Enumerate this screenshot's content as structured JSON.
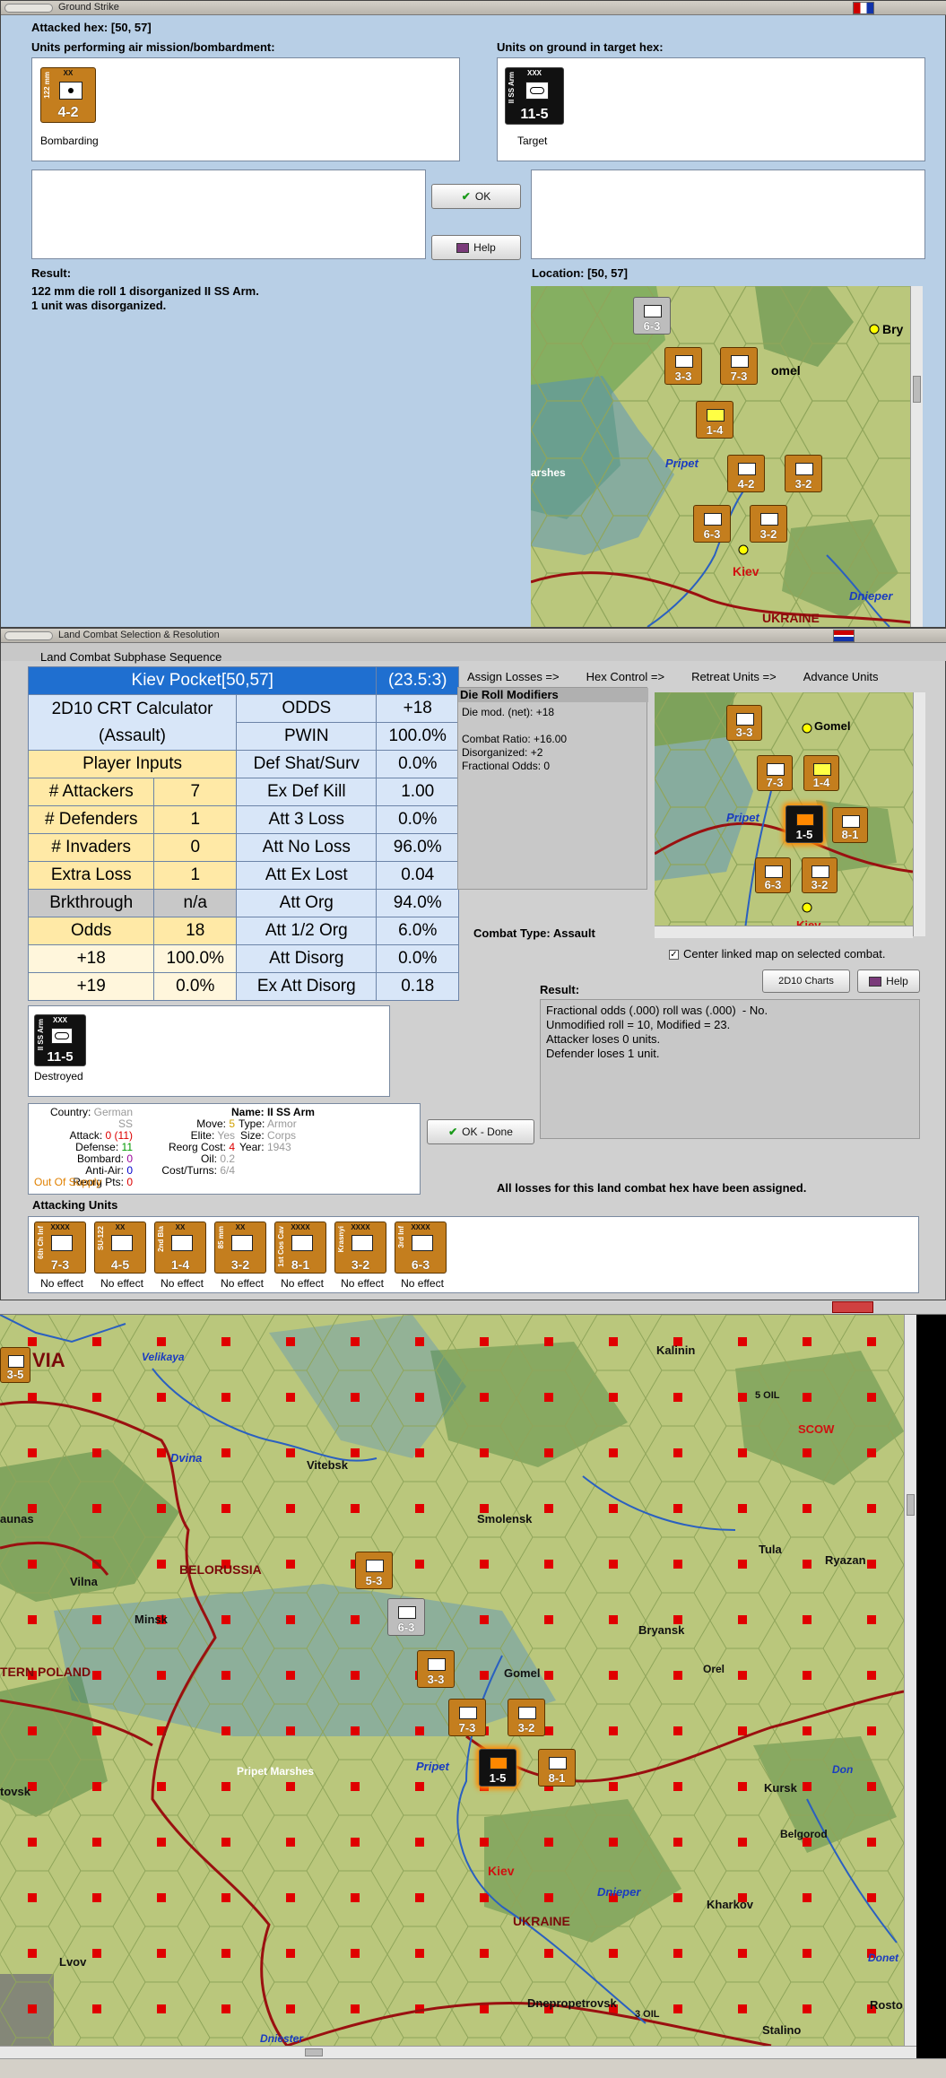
{
  "ground": {
    "title": "Ground Strike",
    "attacked_hex": "Attacked hex: [50, 57]",
    "units_air_label": "Units performing air mission/bombardment:",
    "units_ground_label": "Units on ground in target hex:",
    "air_unit": {
      "side": "122 mm",
      "size": "XX",
      "strength": "4-2",
      "caption": "Bombarding"
    },
    "ground_unit": {
      "side": "II SS Arm",
      "size": "XXX",
      "strength": "11-5",
      "caption": "Target"
    },
    "ok_label": "OK",
    "help_label": "Help",
    "result_label": "Result:",
    "result_lines": "122 mm die roll 1 disorganized II SS Arm.\n1 unit was disorganized.",
    "location_label": "Location:  [50, 57]",
    "map_labels": {
      "bryansk": "Bry",
      "gomel": "omel",
      "marshes": "arshes",
      "pripet": "Pripet",
      "kiev": "Kiev",
      "dnieper": "Dnieper",
      "ukraine": "UKRAINE"
    },
    "map_counters": [
      {
        "side": "XXXXX",
        "strength": "6-3",
        "grey": true
      },
      {
        "side": "XXXX",
        "strength": "3-3"
      },
      {
        "side": "XXXX",
        "strength": "7-3"
      },
      {
        "side": "XX",
        "strength": "1-4"
      },
      {
        "side": "XX",
        "strength": "4-2"
      },
      {
        "side": "XX",
        "strength": "3-2"
      },
      {
        "side": "XXXX",
        "strength": "6-3"
      },
      {
        "side": "XXXX",
        "strength": "3-2"
      }
    ]
  },
  "land": {
    "title": "Land Combat Selection & Resolution",
    "subphase_title": "Land Combat Subphase Sequence",
    "steps": [
      "Assign Losses =>",
      "Hex Control =>",
      "Retreat Units =>",
      "Advance Units"
    ],
    "crt": {
      "header_name": "Kiev Pocket[50,57]",
      "header_ratio": "(23.5:3)",
      "calc_title_1": "2D10 CRT Calculator",
      "calc_title_2": "(Assault)",
      "player_inputs": "Player Inputs",
      "rows_left": [
        {
          "label": "# Attackers",
          "value": "7"
        },
        {
          "label": "# Defenders",
          "value": "1"
        },
        {
          "label": "# Invaders",
          "value": "0"
        },
        {
          "label": "Extra Loss",
          "value": "1"
        },
        {
          "label": "Brkthrough",
          "value": "n/a"
        },
        {
          "label": "Odds",
          "value": "18"
        },
        {
          "label": "+18",
          "value": "100.0%"
        },
        {
          "label": "+19",
          "value": "0.0%"
        }
      ],
      "rows_right": [
        {
          "label": "ODDS",
          "value": "+18"
        },
        {
          "label": "PWIN",
          "value": "100.0%"
        },
        {
          "label": "Def Shat/Surv",
          "value": "0.0%"
        },
        {
          "label": "Ex Def Kill",
          "value": "1.00"
        },
        {
          "label": "Att 3 Loss",
          "value": "0.0%"
        },
        {
          "label": "Att No Loss",
          "value": "96.0%"
        },
        {
          "label": "Att Ex Lost",
          "value": "0.04"
        },
        {
          "label": "Att Org",
          "value": "94.0%"
        },
        {
          "label": "Att 1/2 Org",
          "value": "6.0%"
        },
        {
          "label": "Att Disorg",
          "value": "0.0%"
        },
        {
          "label": "Ex Att Disorg",
          "value": "0.18"
        }
      ]
    },
    "die_roll_title": "Die Roll Modifiers",
    "die_roll_text": "Die mod. (net): +18\n\nCombat Ratio: +16.00\nDisorganized: +2\nFractional Odds: 0",
    "combat_type": "Combat Type:  Assault",
    "center_linked": "Center linked map on selected combat.",
    "charts_label": "2D10 Charts",
    "help_label": "Help",
    "result_label": "Result:",
    "result_text": "Fractional odds (.000) roll was (.000)  - No.\nUnmodified roll = 10, Modified = 23.\nAttacker loses 0 units.\nDefender loses 1 unit.",
    "destroyed_unit": {
      "side": "II SS Arm",
      "size": "XXX",
      "strength": "11-5",
      "caption": "Destroyed"
    },
    "unit_info": {
      "country_label": "Country:",
      "country": "German SS",
      "attack_label": "Attack:",
      "attack": "0",
      "attack2": " (11)",
      "defense_label": "Defense:",
      "defense": "11",
      "bombard_label": "Bombard:",
      "bombard": "0",
      "antiair_label": "Anti-Air:",
      "antiair": "0",
      "reorg_pts_label": "Reorg Pts:",
      "reorg_pts": "0",
      "supply": "Out Of Supply",
      "move_label": "Move:",
      "move": "5",
      "elite_label": "Elite:",
      "elite": "Yes",
      "reorg_cost_label": "Reorg Cost:",
      "reorg_cost": "4",
      "oil_label": "Oil:",
      "oil": "0.2",
      "cost_label": "Cost/Turns:",
      "cost": "6/4",
      "name_label": "Name:",
      "name": "II SS Arm",
      "type_label": "Type:",
      "type": "Armor",
      "size_label": "Size:",
      "size": "Corps",
      "year_label": "Year:",
      "year": "1943"
    },
    "ok_done": "OK - Done",
    "all_losses": "All losses for this land combat hex have been assigned.",
    "attacking_units_label": "Attacking Units",
    "attackers": [
      {
        "side": "6th Ch Inf",
        "size": "XXXX",
        "strength": "7-3",
        "effect": "No effect",
        "type": "inf"
      },
      {
        "side": "SU-122",
        "size": "XX",
        "strength": "4-5",
        "effect": "No effect",
        "type": "art"
      },
      {
        "side": "2nd Bla",
        "size": "XX",
        "strength": "1-4",
        "effect": "No effect",
        "type": "mnt"
      },
      {
        "side": "85 mm",
        "size": "XX",
        "strength": "3-2",
        "effect": "No effect",
        "type": "art"
      },
      {
        "side": "1st Cos Cav",
        "size": "XXXX",
        "strength": "8-1",
        "effect": "No effect",
        "type": "cav"
      },
      {
        "side": "Krasnyi",
        "size": "XXXX",
        "strength": "3-2",
        "effect": "No effect",
        "type": "mtn"
      },
      {
        "side": "3rd Inf",
        "size": "XXXX",
        "strength": "6-3",
        "effect": "No effect",
        "type": "inf"
      }
    ],
    "mini_map_labels": {
      "gomel": "Gomel",
      "pripet": "Pripet",
      "kiev": "Kiev"
    },
    "mini_counters": [
      "3-3",
      "7-3",
      "1-4",
      "1-5",
      "8-1",
      "6-3",
      "3-2"
    ]
  },
  "bigmap": {
    "labels": [
      {
        "id": "via",
        "text": "VIA"
      },
      {
        "id": "velikaya",
        "text": "Velikaya"
      },
      {
        "id": "kalinin",
        "text": "Kalinin"
      },
      {
        "id": "oil",
        "text": "5 OIL"
      },
      {
        "id": "moscow",
        "text": "SCOW"
      },
      {
        "id": "dvina",
        "text": "Dvina"
      },
      {
        "id": "vitebsk",
        "text": "Vitebsk"
      },
      {
        "id": "smolensk",
        "text": "Smolensk"
      },
      {
        "id": "aunas",
        "text": "aunas"
      },
      {
        "id": "tula",
        "text": "Tula"
      },
      {
        "id": "ryazan",
        "text": "Ryazan"
      },
      {
        "id": "belorussia",
        "text": "BELORUSSIA"
      },
      {
        "id": "vilna",
        "text": "Vilna"
      },
      {
        "id": "minsk",
        "text": "Minsk"
      },
      {
        "id": "bryansk",
        "text": "Bryansk"
      },
      {
        "id": "tern-poland",
        "text": "TERN POLAND"
      },
      {
        "id": "gomel",
        "text": "Gomel"
      },
      {
        "id": "orel",
        "text": "Orel"
      },
      {
        "id": "pripet-marshes",
        "text": "Pripet Marshes"
      },
      {
        "id": "pripet",
        "text": "Pripet"
      },
      {
        "id": "tovsk",
        "text": "tovsk"
      },
      {
        "id": "kursk",
        "text": "Kursk"
      },
      {
        "id": "don",
        "text": "Don"
      },
      {
        "id": "belgorod",
        "text": "Belgorod"
      },
      {
        "id": "kiev",
        "text": "Kiev"
      },
      {
        "id": "ukraine",
        "text": "UKRAINE"
      },
      {
        "id": "dnieper",
        "text": "Dnieper"
      },
      {
        "id": "kharkov",
        "text": "Kharkov"
      },
      {
        "id": "lvov",
        "text": "Lvov"
      },
      {
        "id": "donet",
        "text": "Donet"
      },
      {
        "id": "dnepropetrovsk",
        "text": "Dnepropetrovsk"
      },
      {
        "id": "dniester",
        "text": "Dniester"
      },
      {
        "id": "stalino",
        "text": "Stalino"
      },
      {
        "id": "rosto",
        "text": "Rosto"
      },
      {
        "id": "oil2",
        "text": "3 OIL"
      }
    ],
    "counters": [
      "3-5",
      "5-3",
      "6-3",
      "3-3",
      "7-3",
      "3-2",
      "8-1",
      "1-5"
    ]
  },
  "colors": {
    "accent": "#1f6fd0",
    "panel": "#b8cfe6",
    "counter": "#c47e1e",
    "map": "#b9c47a"
  }
}
